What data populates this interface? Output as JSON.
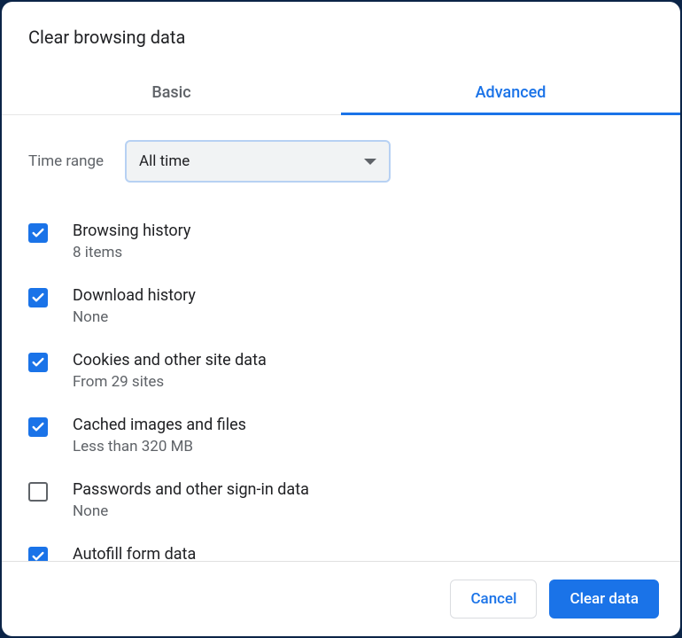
{
  "dialog": {
    "title": "Clear browsing data"
  },
  "tabs": {
    "basic_label": "Basic",
    "advanced_label": "Advanced",
    "active": "advanced"
  },
  "time_range": {
    "label": "Time range",
    "selected": "All time"
  },
  "items": [
    {
      "title": "Browsing history",
      "sub": "8 items",
      "checked": true
    },
    {
      "title": "Download history",
      "sub": "None",
      "checked": true
    },
    {
      "title": "Cookies and other site data",
      "sub": "From 29 sites",
      "checked": true
    },
    {
      "title": "Cached images and files",
      "sub": "Less than 320 MB",
      "checked": true
    },
    {
      "title": "Passwords and other sign-in data",
      "sub": "None",
      "checked": false
    },
    {
      "title": "Autofill form data",
      "sub": "",
      "checked": true
    }
  ],
  "buttons": {
    "cancel": "Cancel",
    "clear": "Clear data"
  }
}
